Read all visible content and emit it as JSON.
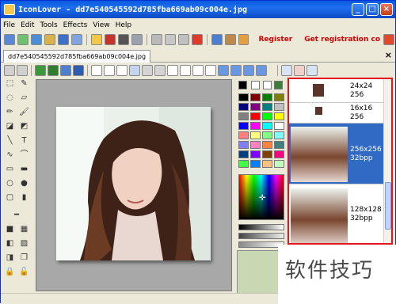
{
  "window": {
    "title": "IconLover - dd7e540545592d785fba669ab09c004e.jpg",
    "minimize": "_",
    "maximize": "□",
    "close": "×"
  },
  "menu": [
    "File",
    "Edit",
    "Tools",
    "Effects",
    "View",
    "Help"
  ],
  "toolbar": {
    "register": "Register",
    "get_code": "Get registration co"
  },
  "tab": {
    "label": "dd7e540545592d785fba669ab09c004e.jpg",
    "close": "×"
  },
  "icon_formats": [
    {
      "size": "24x24",
      "depth": "256"
    },
    {
      "size": "16x16",
      "depth": "256"
    },
    {
      "size": "256x256",
      "depth": "32bpp",
      "selected": true
    },
    {
      "size": "128x128",
      "depth": "32bpp"
    }
  ],
  "watermark": "软件技巧",
  "palette": [
    "#000000",
    "#800000",
    "#008000",
    "#808000",
    "#000080",
    "#800080",
    "#008080",
    "#c0c0c0",
    "#808080",
    "#ff0000",
    "#00ff00",
    "#ffff00",
    "#0000ff",
    "#ff00ff",
    "#00ffff",
    "#ffffff",
    "#ff8080",
    "#ffff80",
    "#80ff80",
    "#80ffff",
    "#8080ff",
    "#ff80c0",
    "#ff8040",
    "#408080",
    "#004080",
    "#8000ff",
    "#804000",
    "#ff0080",
    "#40ff40",
    "#0080ff",
    "#ffc080",
    "#c0ffc0"
  ]
}
